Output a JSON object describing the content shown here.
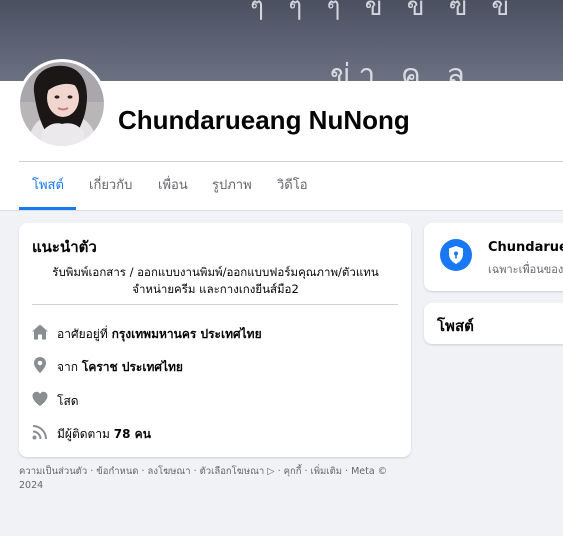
{
  "cover": {
    "text_line1": "ๆ ๆ ๆ ข ข ฃ ข",
    "text_line2": "ข่า คุ ล"
  },
  "profile": {
    "name": "Chundarueang NuNong"
  },
  "tabs": [
    {
      "label": "โพสต์",
      "active": true
    },
    {
      "label": "เกี่ยวกับ",
      "active": false
    },
    {
      "label": "เพื่อน",
      "active": false
    },
    {
      "label": "รูปภาพ",
      "active": false
    },
    {
      "label": "วิดีโอ",
      "active": false
    }
  ],
  "intro": {
    "title": "แนะนำตัว",
    "bio_line1": "รับพิมพ์เอกสาร / ออกแบบงานพิมพ์/ออกแบบฟอร์มคุณภาพ/ตัวแทน",
    "bio_line2": "จำหน่ายครีม และกางเกงยีนส์มือ2",
    "lives_prefix": "อาศัยอยู่ที่",
    "lives_value": "กรุงเทพมหานคร ประเทศไทย",
    "from_prefix": "จาก",
    "from_value": "โคราช ประเทศไทย",
    "relationship": "โสด",
    "followers_prefix": "มีผู้ติดตาม",
    "followers_value": "78 คน",
    "icons": [
      "home-icon",
      "location-pin-icon",
      "heart-icon",
      "rss-icon"
    ]
  },
  "privacy_card": {
    "name": "Chundarueа",
    "sub": "เฉพาะเพื่อนของ"
  },
  "posts_card": {
    "title": "โพสต์"
  },
  "footer": {
    "links": [
      "ความเป็นส่วนตัว",
      "ข้อกำหนด",
      "ลงโฆษณา",
      "ตัวเลือกโฆษณา ▷",
      "คุกกี้",
      "เพิ่มเติม",
      "Meta © 2024"
    ]
  },
  "colors": {
    "accent": "#1877f2",
    "background": "#f0f2f5",
    "muted": "#65676b"
  }
}
